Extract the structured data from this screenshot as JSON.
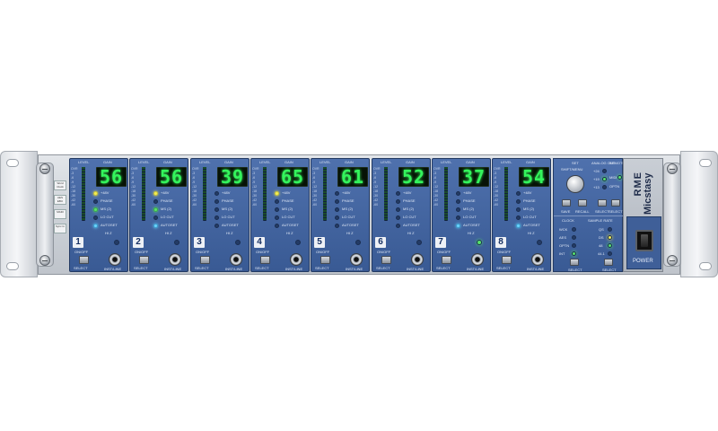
{
  "device": {
    "brand": "RME",
    "model": "Micstasy",
    "power_label": "POWER"
  },
  "colors": {
    "panel_blue": "#3f63a0",
    "display_green": "#34f45c",
    "led_yellow": "#f4ee55",
    "led_green": "#57e26a",
    "led_blue": "#6ad3ff"
  },
  "legend_labels": [
    "Word Clock",
    "AES EBU",
    "MADI",
    "Sync In"
  ],
  "channel_labels": {
    "level": "LEVEL",
    "gain": "GAIN",
    "onoff": "ON/OFF",
    "select": "SELECT",
    "inst_line": "INST/LINE",
    "hiz": "HI Z",
    "options": [
      "+48V",
      "PHASE",
      "MS (2)",
      "LO CUT",
      "AUTOSET"
    ],
    "scale": [
      "OVR",
      "-3",
      "-6",
      "-9",
      "-12",
      "-18",
      "-30",
      "-42",
      "-60"
    ]
  },
  "channels": [
    {
      "number": "1",
      "gain": "56",
      "leds": [
        "yellow",
        "off",
        "green",
        "off",
        "blue"
      ],
      "hiz": false
    },
    {
      "number": "2",
      "gain": "56",
      "leds": [
        "yellow",
        "off",
        "green",
        "off",
        "blue"
      ],
      "hiz": false
    },
    {
      "number": "3",
      "gain": "39",
      "leds": [
        "off",
        "off",
        "off",
        "off",
        "off"
      ],
      "hiz": false
    },
    {
      "number": "4",
      "gain": "65",
      "leds": [
        "yellow",
        "off",
        "off",
        "off",
        "off"
      ],
      "hiz": false
    },
    {
      "number": "5",
      "gain": "61",
      "leds": [
        "off",
        "off",
        "off",
        "off",
        "off"
      ],
      "hiz": false
    },
    {
      "number": "6",
      "gain": "52",
      "leds": [
        "off",
        "off",
        "off",
        "off",
        "off"
      ],
      "hiz": false
    },
    {
      "number": "7",
      "gain": "37",
      "leds": [
        "off",
        "off",
        "off",
        "off",
        "blue"
      ],
      "hiz": true
    },
    {
      "number": "8",
      "gain": "54",
      "leds": [
        "off",
        "off",
        "off",
        "off",
        "blue"
      ],
      "hiz": false
    }
  ],
  "master": {
    "set_label": "SET",
    "knob_label": "SHIFT/MENU",
    "save_label": "SAVE",
    "recall_label": "RECALL",
    "analog_out_label": "ANALOG OUT",
    "analog_out_options": [
      "+24",
      "+19",
      "+13"
    ],
    "analog_select_label": "SELECT",
    "remote_label": "REMOTE",
    "remote_options": [
      "MIDI",
      "OPTN"
    ],
    "remote_select_label": "SELECT",
    "clock_label": "CLOCK",
    "clock_options": [
      "WCK",
      "AES",
      "OPTN",
      "INT"
    ],
    "clock_select_label": "SELECT",
    "sample_rate_label": "SAMPLE RATE",
    "sample_rate_options": [
      "QS",
      "DS",
      "48",
      "44.1"
    ],
    "sample_rate_select_label": "SELECT"
  }
}
